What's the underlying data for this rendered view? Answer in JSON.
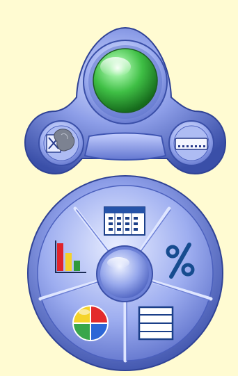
{
  "app": {
    "name": "",
    "background_color": "#fffbd2"
  },
  "status_control": {
    "indicator": {
      "icon": "status-light-icon",
      "state": "on",
      "color": "#3fbf45"
    },
    "left_button": {
      "icon": "map-icon"
    },
    "right_button": {
      "icon": "keyboard-icon"
    }
  },
  "tool_dial": {
    "segments": [
      {
        "id": "table",
        "icon": "table-grid-icon"
      },
      {
        "id": "percent",
        "icon": "percent-icon"
      },
      {
        "id": "list",
        "icon": "list-icon"
      },
      {
        "id": "pie",
        "icon": "pie-chart-icon"
      },
      {
        "id": "bar",
        "icon": "bar-chart-icon"
      }
    ],
    "center_button": {
      "icon": "center-button-icon"
    }
  },
  "theme": {
    "frame_dark": "#3c52ad",
    "frame_mid": "#7f91e0",
    "frame_light": "#cdd6ff",
    "percent_color": "#164c8f",
    "bar_colors": [
      "#e0232b",
      "#f4d12a",
      "#2f9a3b"
    ],
    "pie_colors": [
      "#e32b2b",
      "#2c66d6",
      "#39a64b",
      "#f5d32a"
    ]
  }
}
